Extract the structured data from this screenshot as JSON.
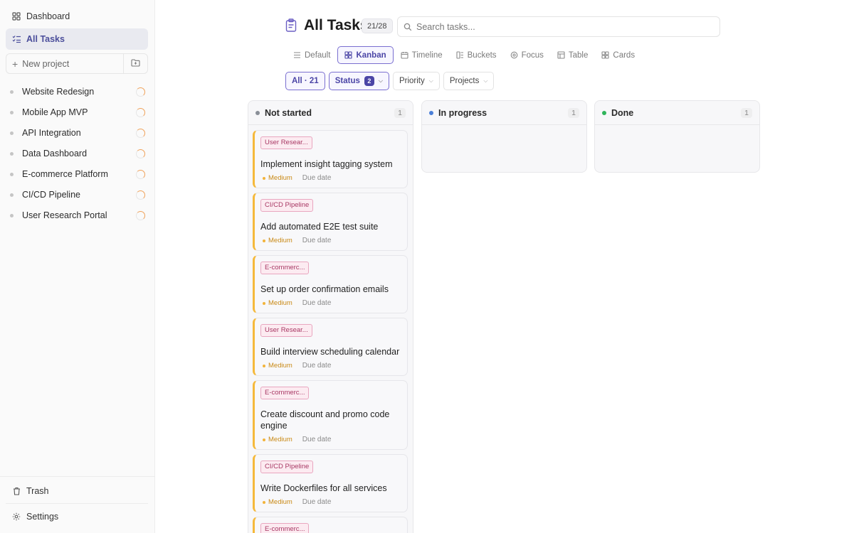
{
  "sidebar": {
    "dashboard": "Dashboard",
    "all_tasks": "All Tasks",
    "new_project": "New project",
    "projects": [
      {
        "name": "Website Redesign"
      },
      {
        "name": "Mobile App MVP"
      },
      {
        "name": "API Integration"
      },
      {
        "name": "Data Dashboard"
      },
      {
        "name": "E-commerce Platform"
      },
      {
        "name": "CI/CD Pipeline"
      },
      {
        "name": "User Research Portal"
      }
    ],
    "trash": "Trash",
    "settings": "Settings"
  },
  "header": {
    "title": "All Tasks",
    "count": "21/28",
    "search_placeholder": "Search tasks..."
  },
  "views": {
    "default": "Default",
    "kanban": "Kanban",
    "timeline": "Timeline",
    "buckets": "Buckets",
    "focus": "Focus",
    "table": "Table",
    "cards": "Cards",
    "active": "Kanban"
  },
  "filters": {
    "all": "All · 21",
    "status": "Status",
    "status_count": "2",
    "priority": "Priority",
    "projects": "Projects"
  },
  "columns": [
    {
      "title": "Not started",
      "count": "1",
      "color": "#8a8f98"
    },
    {
      "title": "In progress",
      "count": "1",
      "color": "#4a7fd8"
    },
    {
      "title": "Done",
      "count": "1",
      "color": "#2fb45a"
    }
  ],
  "cards": [
    {
      "tag": "User Resear...",
      "title": "Implement insight tagging system",
      "priority": "Medium",
      "due": "Due date"
    },
    {
      "tag": "CI/CD Pipeline",
      "title": "Add automated E2E test suite",
      "priority": "Medium",
      "due": "Due date"
    },
    {
      "tag": "E-commerc...",
      "title": "Set up order confirmation emails",
      "priority": "Medium",
      "due": "Due date"
    },
    {
      "tag": "User Resear...",
      "title": "Build interview scheduling calendar",
      "priority": "Medium",
      "due": "Due date"
    },
    {
      "tag": "E-commerc...",
      "title": "Create discount and promo code engine",
      "priority": "Medium",
      "due": "Due date"
    },
    {
      "tag": "CI/CD Pipeline",
      "title": "Write Dockerfiles for all services",
      "priority": "Medium",
      "due": "Due date"
    },
    {
      "tag": "E-commerc...",
      "title": "",
      "priority": "",
      "due": ""
    }
  ]
}
